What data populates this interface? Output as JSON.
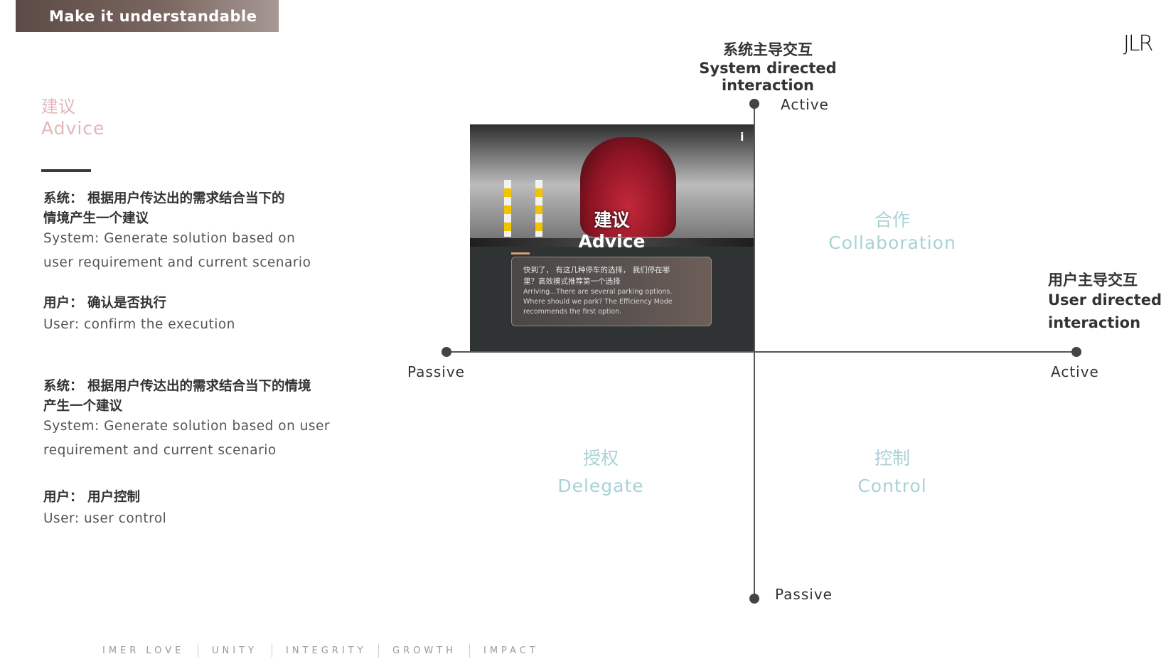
{
  "header": {
    "banner_title": "Make it understandable",
    "logo": "JLR"
  },
  "left": {
    "title_zh": "建议",
    "title_en": "Advice",
    "block1": {
      "system_zh_line1": "系统： 根据用户传达出的需求结合当下的",
      "system_zh_line2": "情境产生一个建议",
      "system_en_line1": "System: Generate solution based on",
      "system_en_line2": "user requirement and current scenario",
      "user_zh": "用户： 确认是否执行",
      "user_en": "User: confirm the execution"
    },
    "block2": {
      "system_zh_line1": "系统： 根据用户传达出的需求结合当下的情境",
      "system_zh_line2": "产生一个建议",
      "system_en_line1": "System: Generate solution based on user",
      "system_en_line2": "requirement and current scenario",
      "user_zh": "用户： 用户控制",
      "user_en": "User: user control"
    }
  },
  "diagram": {
    "top_label_zh": "系统主导交互",
    "top_label_en": "System directed interaction",
    "right_label_zh": "用户主导交互",
    "right_label_en_line1": "User directed",
    "right_label_en_line2": "interaction",
    "v_top": "Active",
    "v_bottom": "Passive",
    "h_left": "Passive",
    "h_right": "Active",
    "quadrants": {
      "top_right_zh": "合作",
      "top_right_en": "Collaboration",
      "bottom_left_zh": "授权",
      "bottom_left_en": "Delegate",
      "bottom_right_zh": "控制",
      "bottom_right_en": "Control"
    },
    "advice_card": {
      "overlay_zh": "建议",
      "overlay_en": "Advice",
      "msg_zh_line1": "快到了， 有这几种停车的选择， 我们停在哪",
      "msg_zh_line2": "里？高效模式推荐第一个选择",
      "msg_en_line1": "Arriving...There are several parking options.",
      "msg_en_line2": "Where should we park? The Efficiency Mode",
      "msg_en_line3": "recommends the first option.",
      "info_icon": "i"
    }
  },
  "footer": {
    "values": [
      "IMER LOVE",
      "UNITY",
      "INTEGRITY",
      "GROWTH",
      "IMPACT"
    ]
  }
}
